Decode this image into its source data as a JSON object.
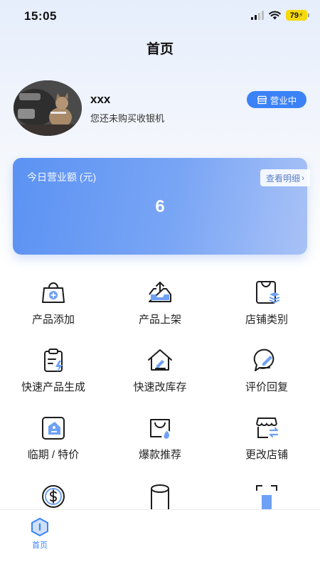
{
  "status_bar": {
    "time": "15:05",
    "battery": "79"
  },
  "header": {
    "title": "首页"
  },
  "profile": {
    "name": "xxx",
    "subtitle": "您还未购买收银机",
    "status": "营业中"
  },
  "revenue": {
    "label": "今日营业额 (元)",
    "value": "6",
    "detail": "查看明细"
  },
  "grid": [
    {
      "label": "产品添加",
      "icon": "bag-plus-icon"
    },
    {
      "label": "产品上架",
      "icon": "upload-tray-icon"
    },
    {
      "label": "店铺类别",
      "icon": "shop-category-icon"
    },
    {
      "label": "快速产品生成",
      "icon": "clipboard-bolt-icon"
    },
    {
      "label": "快速改库存",
      "icon": "house-edit-icon"
    },
    {
      "label": "评价回复",
      "icon": "comment-edit-icon"
    },
    {
      "label": "临期 / 特价",
      "icon": "tag-icon"
    },
    {
      "label": "爆款推荐",
      "icon": "hot-bag-icon"
    },
    {
      "label": "更改店铺",
      "icon": "store-swap-icon"
    }
  ],
  "partial_icons": [
    "dollar-coin-icon",
    "cylinder-icon",
    "scan-frame-icon"
  ],
  "bottom_nav": {
    "home_label": "首页"
  }
}
